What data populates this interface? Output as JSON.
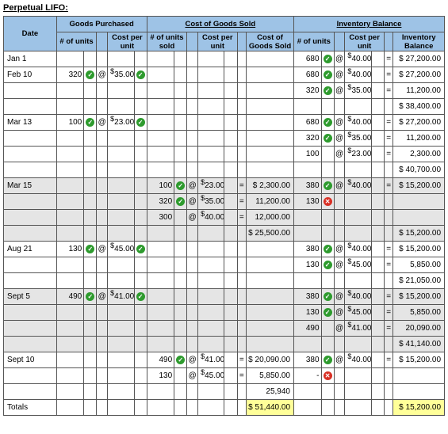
{
  "title": "Perpetual LIFO:",
  "headers": {
    "group_purch": "Goods Purchased",
    "group_cogs": "Cost of Goods Sold",
    "group_bal": "Inventory Balance",
    "date": "Date",
    "units": "# of units",
    "cost_per_unit": "Cost per unit",
    "units_sold": "# of units sold",
    "cogs": "Cost of Goods Sold",
    "inv_bal": "Inventory Balance"
  },
  "rows": [
    {
      "date": "Jan 1",
      "shade": false,
      "cells": {
        "b_units": "680",
        "b_um": "ok",
        "b_at": "@",
        "b_cost": "40.00",
        "b_cm": "",
        "b_eq": "=",
        "b_bal": "$ 27,200.00"
      }
    },
    {
      "date": "Feb 10",
      "shade": false,
      "cells": {
        "p_units": "320",
        "p_um": "ok",
        "p_at": "@",
        "p_cost": "35.00",
        "p_cm": "ok",
        "b_units": "680",
        "b_um": "ok",
        "b_at": "@",
        "b_cost": "40.00",
        "b_cm": "",
        "b_eq": "=",
        "b_bal": "$ 27,200.00"
      }
    },
    {
      "shade": false,
      "cells": {
        "b_units": "320",
        "b_um": "ok",
        "b_at": "@",
        "b_cost": "35.00",
        "b_cm": "",
        "b_eq": "=",
        "b_bal": "11,200.00"
      }
    },
    {
      "shade": false,
      "cells": {
        "b_bal": "$ 38,400.00"
      }
    },
    {
      "date": "Mar 13",
      "shade": false,
      "cells": {
        "p_units": "100",
        "p_um": "ok",
        "p_at": "@",
        "p_cost": "23.00",
        "p_cm": "ok",
        "b_units": "680",
        "b_um": "ok",
        "b_at": "@",
        "b_cost": "40.00",
        "b_cm": "",
        "b_eq": "=",
        "b_bal": "$ 27,200.00"
      }
    },
    {
      "shade": false,
      "cells": {
        "b_units": "320",
        "b_um": "ok",
        "b_at": "@",
        "b_cost": "35.00",
        "b_cm": "",
        "b_eq": "=",
        "b_bal": "11,200.00"
      }
    },
    {
      "shade": false,
      "cells": {
        "b_units": "100",
        "b_um": "",
        "b_at": "@",
        "b_cost": "23.00",
        "b_cm": "",
        "b_eq": "=",
        "b_bal": "2,300.00"
      }
    },
    {
      "shade": false,
      "cells": {
        "b_bal": "$ 40,700.00"
      }
    },
    {
      "date": "Mar 15",
      "shade": true,
      "cells": {
        "s_units": "100",
        "s_um": "ok",
        "s_at": "@",
        "s_cost": "23.00",
        "s_cm": "",
        "s_eq": "=",
        "s_cogs": "$  2,300.00",
        "b_units": "380",
        "b_um": "ok",
        "b_at": "@",
        "b_cost": "40.00",
        "b_cm": "",
        "b_eq": "=",
        "b_bal": "$ 15,200.00"
      }
    },
    {
      "shade": true,
      "cells": {
        "s_units": "320",
        "s_um": "ok",
        "s_at": "@",
        "s_cost": "35.00",
        "s_cm": "",
        "s_eq": "=",
        "s_cogs": "11,200.00",
        "b_units": "130",
        "b_um": "bad"
      }
    },
    {
      "shade": true,
      "cells": {
        "s_units": "300",
        "s_um": "",
        "s_at": "@",
        "s_cost": "40.00",
        "s_cm": "",
        "s_eq": "=",
        "s_cogs": "12,000.00"
      }
    },
    {
      "shade": true,
      "cells": {
        "s_cogs": "$ 25,500.00",
        "b_bal": "$ 15,200.00"
      }
    },
    {
      "date": "Aug 21",
      "shade": false,
      "cells": {
        "p_units": "130",
        "p_um": "ok",
        "p_at": "@",
        "p_cost": "45.00",
        "p_cm": "ok",
        "b_units": "380",
        "b_um": "ok",
        "b_at": "@",
        "b_cost": "40.00",
        "b_cm": "",
        "b_eq": "=",
        "b_bal": "$ 15,200.00"
      }
    },
    {
      "shade": false,
      "cells": {
        "b_units": "130",
        "b_um": "ok",
        "b_at": "@",
        "b_cost": "45.00",
        "b_cm": "",
        "b_eq": "=",
        "b_bal": "5,850.00"
      }
    },
    {
      "shade": false,
      "cells": {
        "b_bal": "$ 21,050.00"
      }
    },
    {
      "date": "Sept 5",
      "shade": true,
      "cells": {
        "p_units": "490",
        "p_um": "ok",
        "p_at": "@",
        "p_cost": "41.00",
        "p_cm": "ok",
        "b_units": "380",
        "b_um": "ok",
        "b_at": "@",
        "b_cost": "40.00",
        "b_cm": "",
        "b_eq": "=",
        "b_bal": "$ 15,200.00"
      }
    },
    {
      "shade": true,
      "cells": {
        "b_units": "130",
        "b_um": "ok",
        "b_at": "@",
        "b_cost": "45.00",
        "b_cm": "",
        "b_eq": "=",
        "b_bal": "5,850.00"
      }
    },
    {
      "shade": true,
      "cells": {
        "b_units": "490",
        "b_um": "",
        "b_at": "@",
        "b_cost": "41.00",
        "b_cm": "",
        "b_eq": "=",
        "b_bal": "20,090.00"
      }
    },
    {
      "shade": true,
      "cells": {
        "b_bal": "$ 41,140.00"
      }
    },
    {
      "date": "Sept 10",
      "shade": false,
      "cells": {
        "s_units": "490",
        "s_um": "ok",
        "s_at": "@",
        "s_cost": "41.00",
        "s_cm": "",
        "s_eq": "=",
        "s_cogs": "$ 20,090.00",
        "b_units": "380",
        "b_um": "ok",
        "b_at": "@",
        "b_cost": "40.00",
        "b_cm": "",
        "b_eq": "=",
        "b_bal": "$ 15,200.00"
      }
    },
    {
      "shade": false,
      "cells": {
        "s_units": "130",
        "s_um": "",
        "s_at": "@",
        "s_cost": "45.00",
        "s_cm": "",
        "s_eq": "=",
        "s_cogs": "5,850.00",
        "b_units": "-",
        "b_um": "bad"
      }
    },
    {
      "shade": false,
      "cells": {
        "s_cogs": "25,940"
      }
    }
  ],
  "totals": {
    "label": "Totals",
    "cogs": "$  51,440.00",
    "bal": "$  15,200.00"
  },
  "marks": {
    "ok": "✓",
    "bad": "✕",
    "at": "@"
  }
}
